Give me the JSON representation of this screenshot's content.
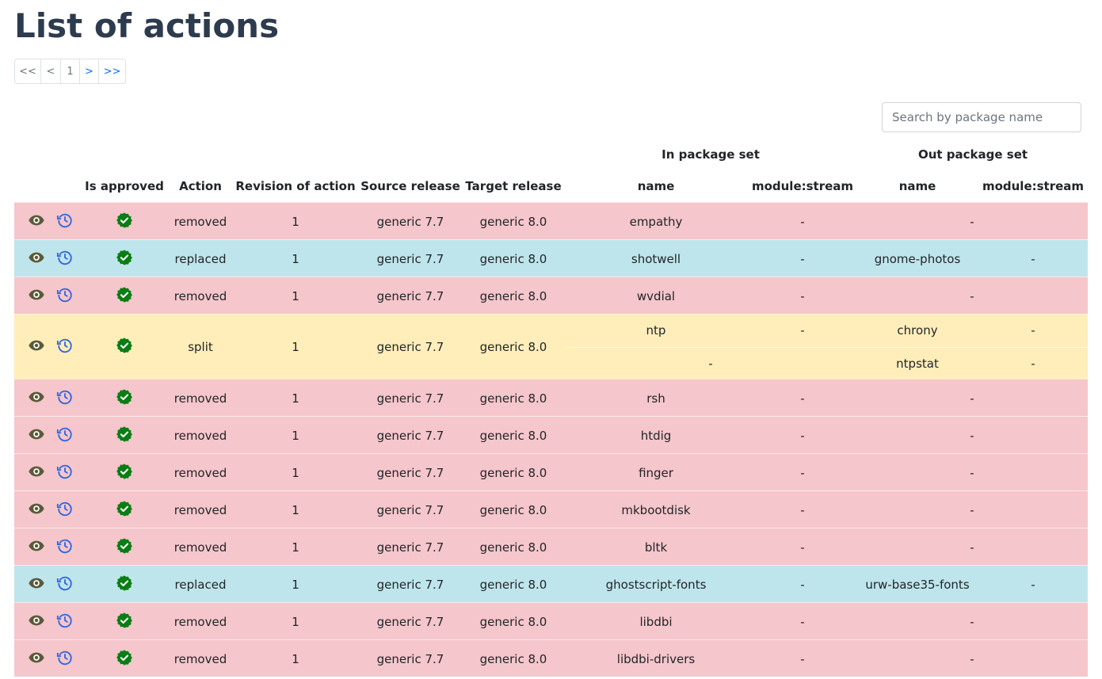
{
  "title": "List of actions",
  "pagination": {
    "first": "<<",
    "prev": "<",
    "current": "1",
    "next": ">",
    "last": ">>"
  },
  "search": {
    "placeholder": "Search by package name"
  },
  "headers": {
    "in_group": "In package set",
    "out_group": "Out package set",
    "is_approved": "Is approved",
    "action": "Action",
    "revision": "Revision of action",
    "source": "Source release",
    "target": "Target release",
    "in_name": "name",
    "in_module": "module:stream",
    "out_name": "name",
    "out_module": "module:stream"
  },
  "icons": {
    "view": "eye-icon",
    "history": "history-icon",
    "approved": "check-badge-icon"
  },
  "colors": {
    "removed": "#f5c6cb",
    "replaced": "#bee5eb",
    "split": "#ffeeba",
    "approved": "#0a7d14",
    "eye": "#5a5a3a",
    "history": "#3366dd"
  },
  "rows": [
    {
      "type": "removed",
      "action": "removed",
      "revision": "1",
      "source": "generic 7.7",
      "target": "generic 8.0",
      "in_name": "empathy",
      "in_module": "-",
      "out_name": "-",
      "out_module": ""
    },
    {
      "type": "replaced",
      "action": "replaced",
      "revision": "1",
      "source": "generic 7.7",
      "target": "generic 8.0",
      "in_name": "shotwell",
      "in_module": "-",
      "out_name": "gnome-photos",
      "out_module": "-"
    },
    {
      "type": "removed",
      "action": "removed",
      "revision": "1",
      "source": "generic 7.7",
      "target": "generic 8.0",
      "in_name": "wvdial",
      "in_module": "-",
      "out_name": "-",
      "out_module": ""
    },
    {
      "type": "split",
      "action": "split",
      "revision": "1",
      "source": "generic 7.7",
      "target": "generic 8.0",
      "sub": [
        {
          "in_name": "ntp",
          "in_module": "-",
          "out_name": "chrony",
          "out_module": "-"
        },
        {
          "in_dash": "-",
          "out_name": "ntpstat",
          "out_module": "-"
        }
      ]
    },
    {
      "type": "removed",
      "action": "removed",
      "revision": "1",
      "source": "generic 7.7",
      "target": "generic 8.0",
      "in_name": "rsh",
      "in_module": "-",
      "out_name": "-",
      "out_module": ""
    },
    {
      "type": "removed",
      "action": "removed",
      "revision": "1",
      "source": "generic 7.7",
      "target": "generic 8.0",
      "in_name": "htdig",
      "in_module": "-",
      "out_name": "-",
      "out_module": ""
    },
    {
      "type": "removed",
      "action": "removed",
      "revision": "1",
      "source": "generic 7.7",
      "target": "generic 8.0",
      "in_name": "finger",
      "in_module": "-",
      "out_name": "-",
      "out_module": ""
    },
    {
      "type": "removed",
      "action": "removed",
      "revision": "1",
      "source": "generic 7.7",
      "target": "generic 8.0",
      "in_name": "mkbootdisk",
      "in_module": "-",
      "out_name": "-",
      "out_module": ""
    },
    {
      "type": "removed",
      "action": "removed",
      "revision": "1",
      "source": "generic 7.7",
      "target": "generic 8.0",
      "in_name": "bltk",
      "in_module": "-",
      "out_name": "-",
      "out_module": ""
    },
    {
      "type": "replaced",
      "action": "replaced",
      "revision": "1",
      "source": "generic 7.7",
      "target": "generic 8.0",
      "in_name": "ghostscript-fonts",
      "in_module": "-",
      "out_name": "urw-base35-fonts",
      "out_module": "-"
    },
    {
      "type": "removed",
      "action": "removed",
      "revision": "1",
      "source": "generic 7.7",
      "target": "generic 8.0",
      "in_name": "libdbi",
      "in_module": "-",
      "out_name": "-",
      "out_module": ""
    },
    {
      "type": "removed",
      "action": "removed",
      "revision": "1",
      "source": "generic 7.7",
      "target": "generic 8.0",
      "in_name": "libdbi-drivers",
      "in_module": "-",
      "out_name": "-",
      "out_module": ""
    }
  ]
}
